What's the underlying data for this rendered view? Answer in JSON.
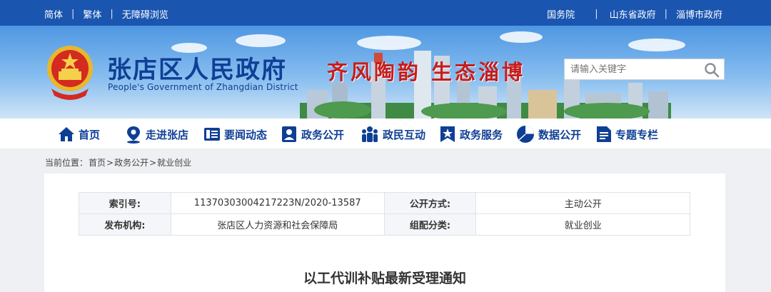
{
  "topbar": {
    "left_links": [
      "简体",
      "繁体",
      "无障碍浏览"
    ],
    "right_links": [
      "国务院",
      "山东省政府",
      "淄博市政府"
    ]
  },
  "header": {
    "title": "张店区人民政府",
    "subtitle": "People's Government of Zhangdian District",
    "slogan": "齐风陶韵  生态淄博",
    "search_placeholder": "请输入关键字"
  },
  "nav": {
    "items": [
      {
        "label": "首页",
        "icon": "home-icon"
      },
      {
        "label": "走进张店",
        "icon": "location-pin-icon"
      },
      {
        "label": "要闻动态",
        "icon": "news-icon"
      },
      {
        "label": "政务公开",
        "icon": "document-person-icon"
      },
      {
        "label": "政民互动",
        "icon": "people-group-icon"
      },
      {
        "label": "政务服务",
        "icon": "star-bookmark-icon"
      },
      {
        "label": "数据公开",
        "icon": "pie-chart-icon"
      },
      {
        "label": "专题专栏",
        "icon": "file-list-icon"
      }
    ]
  },
  "breadcrumb": {
    "prefix": "当前位置：",
    "items": [
      "首页",
      "政务公开",
      "就业创业"
    ],
    "separator": ">"
  },
  "meta": {
    "index_label": "索引号:",
    "index_value": "11370303004217223N/2020-13587",
    "publish_mode_label": "公开方式:",
    "publish_mode_value": "主动公开",
    "agency_label": "发布机构:",
    "agency_value": "张店区人力资源和社会保障局",
    "category_label": "组配分类:",
    "category_value": "就业创业"
  },
  "article": {
    "title": "以工代训补贴最新受理通知"
  },
  "colors": {
    "brand_blue": "#1a55b0",
    "title_blue": "#0f3f95",
    "slogan_red": "#c51d1d"
  }
}
